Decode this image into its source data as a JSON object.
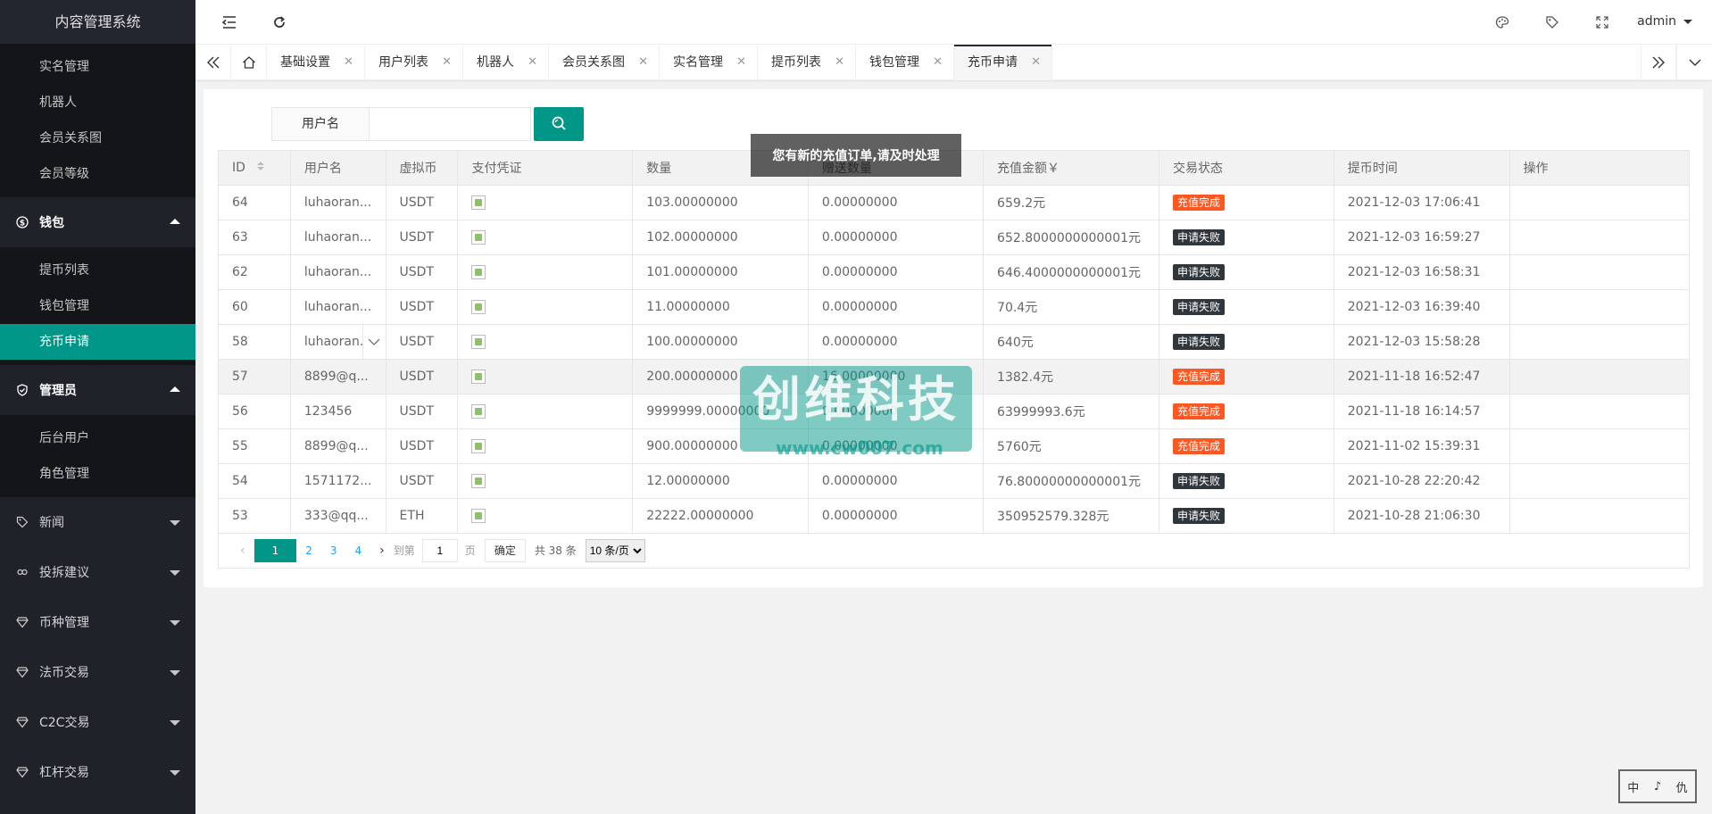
{
  "app": {
    "title": "内容管理系统",
    "user": "admin"
  },
  "sidebar": {
    "top_items": [
      {
        "label": "实名管理"
      },
      {
        "label": "机器人"
      },
      {
        "label": "会员关系图"
      },
      {
        "label": "会员等级"
      }
    ],
    "wallet": {
      "label": "钱包",
      "items": [
        {
          "label": "提币列表"
        },
        {
          "label": "钱包管理"
        },
        {
          "label": "充币申请"
        }
      ]
    },
    "admin": {
      "label": "管理员",
      "items": [
        {
          "label": "后台用户"
        },
        {
          "label": "角色管理"
        }
      ]
    },
    "groups": [
      {
        "label": "新闻",
        "icon": "tag-icon"
      },
      {
        "label": "投拆建议",
        "icon": "link-icon"
      },
      {
        "label": "币种管理",
        "icon": "diamond-icon"
      },
      {
        "label": "法币交易",
        "icon": "diamond-icon"
      },
      {
        "label": "C2C交易",
        "icon": "diamond-icon"
      },
      {
        "label": "杠杆交易",
        "icon": "diamond-icon"
      }
    ]
  },
  "tabs": [
    {
      "label": "基础设置"
    },
    {
      "label": "用户列表"
    },
    {
      "label": "机器人"
    },
    {
      "label": "会员关系图"
    },
    {
      "label": "实名管理"
    },
    {
      "label": "提币列表"
    },
    {
      "label": "钱包管理"
    },
    {
      "label": "充币申请",
      "active": true
    }
  ],
  "search": {
    "label": "用户名",
    "value": ""
  },
  "table": {
    "columns": [
      "ID",
      "用户名",
      "虚拟币",
      "支付凭证",
      "数量",
      "赠送数量",
      "充值金额￥",
      "交易状态",
      "提币时间",
      "操作"
    ],
    "rows": [
      {
        "id": "64",
        "user": "luhaoran...",
        "coin": "USDT",
        "qty": "103.00000000",
        "gift": "0.00000000",
        "amount": "659.2元",
        "status": "充值完成",
        "time": "2021-12-03 17:06:41"
      },
      {
        "id": "63",
        "user": "luhaoran...",
        "coin": "USDT",
        "qty": "102.00000000",
        "gift": "0.00000000",
        "amount": "652.8000000000001元",
        "status": "申请失败",
        "time": "2021-12-03 16:59:27"
      },
      {
        "id": "62",
        "user": "luhaoran...",
        "coin": "USDT",
        "qty": "101.00000000",
        "gift": "0.00000000",
        "amount": "646.4000000000001元",
        "status": "申请失败",
        "time": "2021-12-03 16:58:31"
      },
      {
        "id": "60",
        "user": "luhaoran...",
        "coin": "USDT",
        "qty": "11.00000000",
        "gift": "0.00000000",
        "amount": "70.4元",
        "status": "申请失败",
        "time": "2021-12-03 16:39:40"
      },
      {
        "id": "58",
        "user": "luhaoran...",
        "coin": "USDT",
        "qty": "100.00000000",
        "gift": "0.00000000",
        "amount": "640元",
        "status": "申请失败",
        "time": "2021-12-03 15:58:28"
      },
      {
        "id": "57",
        "user": "8899@q...",
        "coin": "USDT",
        "qty": "200.00000000",
        "gift": "16.00000000",
        "amount": "1382.4元",
        "status": "充值完成",
        "time": "2021-11-18 16:52:47"
      },
      {
        "id": "56",
        "user": "123456",
        "coin": "USDT",
        "qty": "9999999.00000000",
        "gift": "0.00000000",
        "amount": "63999993.6元",
        "status": "充值完成",
        "time": "2021-11-18 16:14:57"
      },
      {
        "id": "55",
        "user": "8899@q...",
        "coin": "USDT",
        "qty": "900.00000000",
        "gift": "0.00000000",
        "amount": "5760元",
        "status": "充值完成",
        "time": "2021-11-02 15:39:31"
      },
      {
        "id": "54",
        "user": "1571172...",
        "coin": "USDT",
        "qty": "12.00000000",
        "gift": "0.00000000",
        "amount": "76.80000000000001元",
        "status": "申请失败",
        "time": "2021-10-28 22:20:42"
      },
      {
        "id": "53",
        "user": "333@qq...",
        "coin": "ETH",
        "qty": "22222.00000000",
        "gift": "0.00000000",
        "amount": "350952579.328元",
        "status": "申请失败",
        "time": "2021-10-28 21:06:30"
      }
    ]
  },
  "status_colors": {
    "充值完成": "#ff5722",
    "申请失败": "#2f363c"
  },
  "pager": {
    "pages": [
      "1",
      "2",
      "3",
      "4"
    ],
    "goto_label": "到第",
    "goto_value": "1",
    "page_unit": "页",
    "ok_label": "确定",
    "total": "共 38 条",
    "per_page": "10 条/页"
  },
  "toast": "您有新的充值订单,请及时处理",
  "watermark": {
    "main": "创维科技",
    "sub": "www.cw007.com"
  },
  "stamp": [
    "中",
    "♪",
    "仇"
  ],
  "colors": {
    "accent": "#009688",
    "sidebar_bg": "#20222a"
  }
}
